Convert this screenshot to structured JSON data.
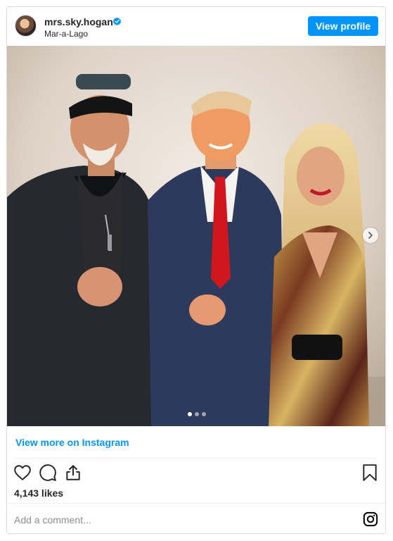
{
  "header": {
    "username": "mrs.sky.hogan",
    "location": "Mar-a-Lago",
    "view_profile_label": "View profile"
  },
  "post": {
    "carousel_total": 3,
    "carousel_current": 1
  },
  "footer": {
    "view_more_label": "View more on Instagram",
    "likes": "4,143 likes",
    "comment_placeholder": "Add a comment..."
  },
  "colors": {
    "accent": "#0095f6",
    "text": "#262626",
    "muted": "#8e8e8e"
  },
  "icons": [
    "verified-badge-icon",
    "heart-icon",
    "comment-icon",
    "share-icon",
    "bookmark-icon",
    "instagram-icon",
    "chevron-right-icon"
  ]
}
